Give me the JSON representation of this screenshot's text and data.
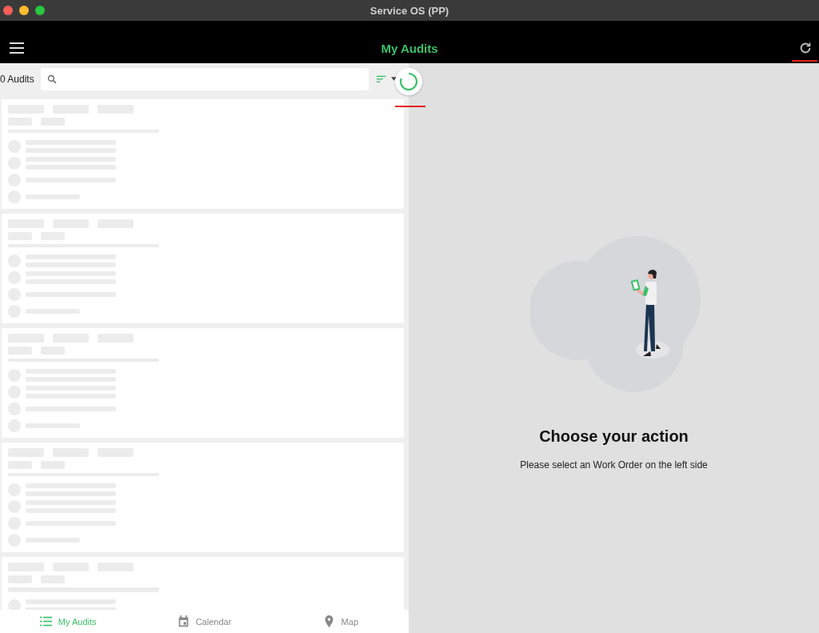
{
  "window": {
    "title": "Service OS (PP)"
  },
  "header": {
    "title": "My Audits"
  },
  "toolbar": {
    "count": "0 Audits"
  },
  "tabs": [
    {
      "label": "My Audits",
      "selected": true
    },
    {
      "label": "Calendar",
      "selected": false
    },
    {
      "label": "Map",
      "selected": false
    }
  ],
  "empty_state": {
    "title": "Choose your action",
    "message": "Please select an Work Order on the left side"
  }
}
